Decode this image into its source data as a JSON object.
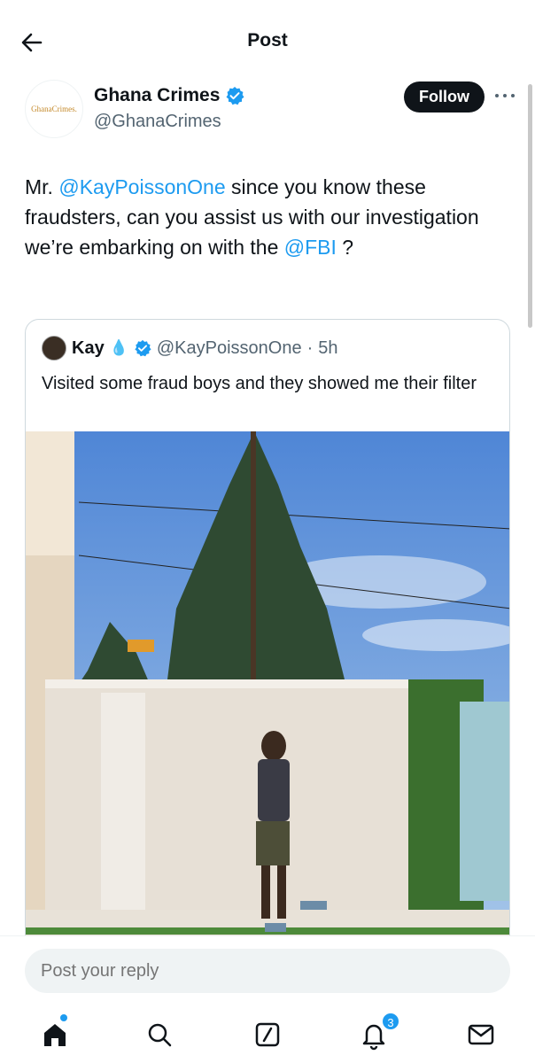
{
  "header": {
    "title": "Post",
    "back_icon": "arrow-left-icon"
  },
  "author": {
    "avatar_text": "GhanaCrimes.",
    "name": "Ghana Crimes",
    "handle": "@GhanaCrimes",
    "verified_icon": "verified-badge-icon",
    "follow_label": "Follow",
    "more_icon": "more-dots-icon"
  },
  "post": {
    "text_1": "Mr. ",
    "mention_1": "@KayPoissonOne",
    "text_2": " since you know these fraudsters, can you assist us with our investigation we’re embarking on with the ",
    "mention_2": "@FBI",
    "text_3": " ?"
  },
  "quote": {
    "name": "Kay",
    "emoji": "💧",
    "handle": "@KayPoissonOne",
    "separator": "·",
    "time": "5h",
    "text": "Visited some fraud boys and they showed me their filter",
    "image_alt": "man-walking-beside-wall-photo"
  },
  "reply": {
    "placeholder": "Post your reply"
  },
  "tabbar": {
    "items": [
      "home-icon",
      "search-icon",
      "grok-icon",
      "notifications-icon",
      "messages-icon"
    ],
    "notification_count": "3"
  },
  "colors": {
    "accent": "#1d9bf0",
    "text": "#0f1419",
    "muted": "#536471"
  }
}
